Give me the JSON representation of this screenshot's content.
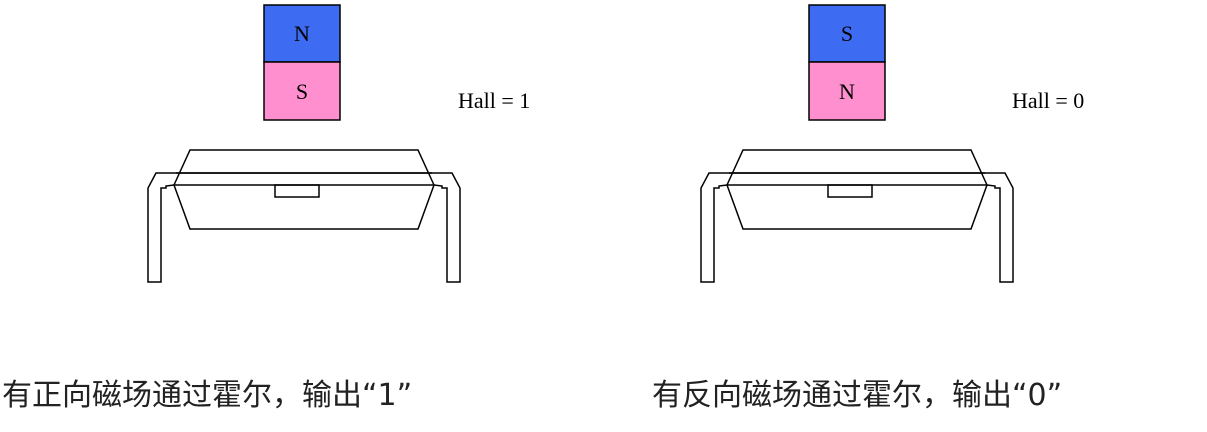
{
  "colors": {
    "north_pole": "#3d6cf2",
    "south_pole": "#ff8fcf"
  },
  "panels": [
    {
      "magnet": {
        "top": "N",
        "bottom": "S"
      },
      "hall_label": "Hall = 1",
      "caption": "有正向磁场通过霍尔，输出“1”"
    },
    {
      "magnet": {
        "top": "S",
        "bottom": "N"
      },
      "hall_label": "Hall = 0",
      "caption": "有反向磁场通过霍尔，输出“0”"
    }
  ]
}
